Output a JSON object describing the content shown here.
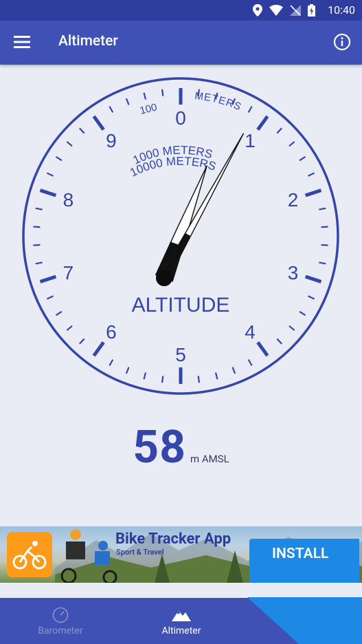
{
  "status_bar": {
    "time": "10:40"
  },
  "app_bar": {
    "title": "Altimeter"
  },
  "gauge": {
    "dial_numbers": [
      "0",
      "1",
      "2",
      "3",
      "4",
      "5",
      "6",
      "7",
      "8",
      "9"
    ],
    "small_scale_label": "100",
    "meters_label": "METERS",
    "inner_label_1": "1000 METERS",
    "inner_label_2": "10000 METERS",
    "center_label": "ALTITUDE",
    "long_hand_reading": 0.58,
    "short_hand_reading": 0.058,
    "accent_color": "#3446a8"
  },
  "reading": {
    "value": "58",
    "unit": "m AMSL"
  },
  "ad": {
    "title": "Bike Tracker App",
    "subtitle": "Sport & Travel",
    "install_label": "INSTALL",
    "icon": "cyclist-icon"
  },
  "bottom_nav": {
    "items": [
      {
        "label": "Barometer",
        "icon": "gauge-icon",
        "active": false
      },
      {
        "label": "Altimeter",
        "icon": "mountain-icon",
        "active": true
      }
    ]
  }
}
